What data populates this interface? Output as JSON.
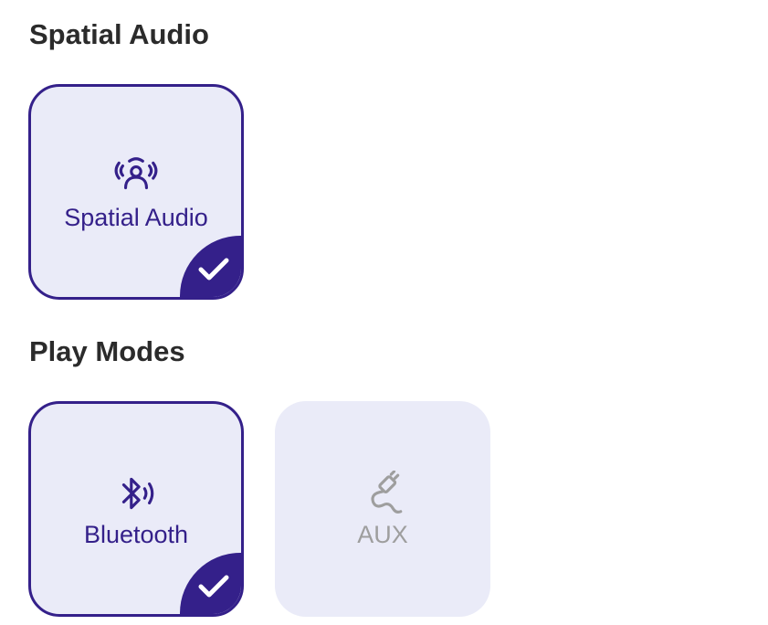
{
  "spatial_section": {
    "title": "Spatial Audio",
    "options": [
      {
        "label": "Spatial Audio",
        "icon": "spatial-audio-icon",
        "selected": true
      }
    ]
  },
  "play_modes_section": {
    "title": "Play Modes",
    "options": [
      {
        "label": "Bluetooth",
        "icon": "bluetooth-audio-icon",
        "selected": true
      },
      {
        "label": "AUX",
        "icon": "aux-cable-icon",
        "selected": false
      }
    ]
  },
  "colors": {
    "accent": "#34208a",
    "tile_background": "#eaebf8",
    "inactive_text": "#9e9e9e",
    "heading_text": "#2b2b2b"
  }
}
